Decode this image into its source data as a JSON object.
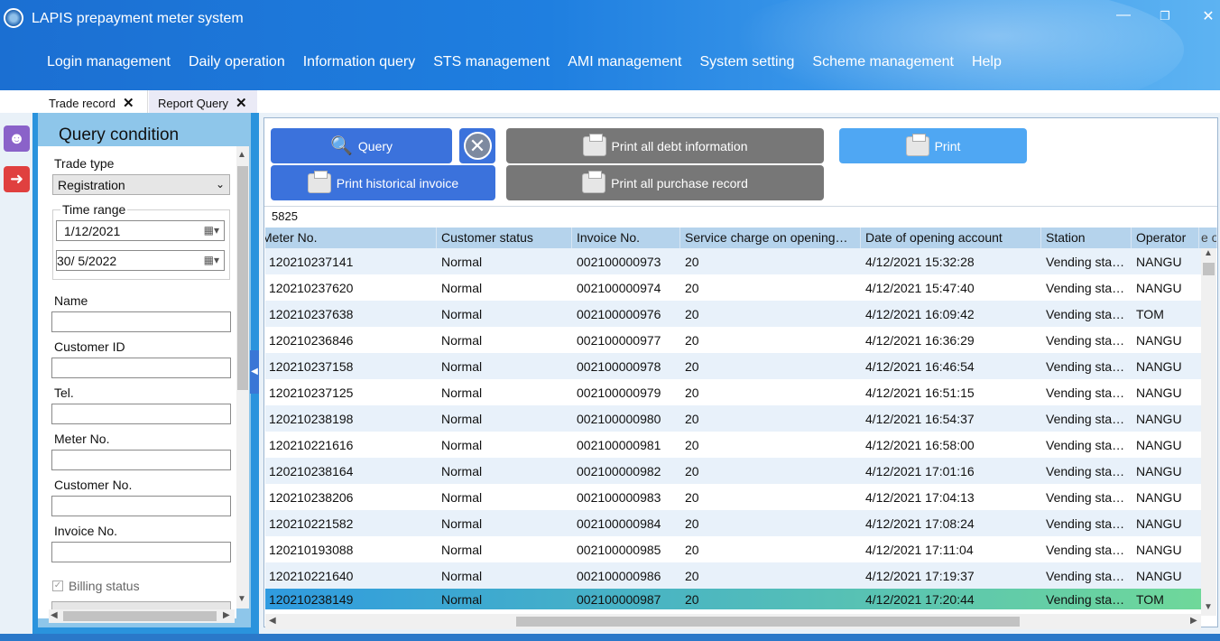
{
  "app": {
    "title": "LAPIS prepayment meter system"
  },
  "window_controls": {
    "minimize": "—",
    "restore": "❐",
    "close": "✕"
  },
  "menu": [
    "Login management",
    "Daily operation",
    "Information query",
    "STS management",
    "AMI management",
    "System setting",
    "Scheme management",
    "Help"
  ],
  "tabs": [
    {
      "label": "Trade record",
      "close": "✕"
    },
    {
      "label": "Report Query",
      "close": "✕"
    }
  ],
  "query": {
    "title": "Query condition",
    "trade_type_label": "Trade type",
    "trade_type_value": "Registration",
    "time_range_label": "Time range",
    "date_from": "1/12/2021",
    "date_to": "30/  5/2022",
    "fields": [
      "Name",
      "Customer ID",
      "Tel.",
      "Meter No.",
      "Customer No.",
      "Invoice No."
    ],
    "billing_status_label": "Billing status",
    "billing_status_checked": true
  },
  "toolbar": {
    "query": "Query",
    "print_debt": "Print all debt information",
    "print": "Print",
    "print_historical": "Print historical invoice",
    "print_purchase": "Print all purchase record"
  },
  "record_count": "5825",
  "table": {
    "columns": [
      "Meter No.",
      "Customer status",
      "Invoice No.",
      "Service charge on opening…",
      "Date of opening account",
      "Station",
      "Operator"
    ],
    "rows": [
      [
        "120210237141",
        "Normal",
        "002100000973",
        "20",
        "4/12/2021 15:32:28",
        "Vending sta…",
        "NANGU"
      ],
      [
        "120210237620",
        "Normal",
        "002100000974",
        "20",
        "4/12/2021 15:47:40",
        "Vending sta…",
        "NANGU"
      ],
      [
        "120210237638",
        "Normal",
        "002100000976",
        "20",
        "4/12/2021 16:09:42",
        "Vending sta…",
        "TOM"
      ],
      [
        "120210236846",
        "Normal",
        "002100000977",
        "20",
        "4/12/2021 16:36:29",
        "Vending sta…",
        "NANGU"
      ],
      [
        "120210237158",
        "Normal",
        "002100000978",
        "20",
        "4/12/2021 16:46:54",
        "Vending sta…",
        "NANGU"
      ],
      [
        "120210237125",
        "Normal",
        "002100000979",
        "20",
        "4/12/2021 16:51:15",
        "Vending sta…",
        "NANGU"
      ],
      [
        "120210238198",
        "Normal",
        "002100000980",
        "20",
        "4/12/2021 16:54:37",
        "Vending sta…",
        "NANGU"
      ],
      [
        "120210221616",
        "Normal",
        "002100000981",
        "20",
        "4/12/2021 16:58:00",
        "Vending sta…",
        "NANGU"
      ],
      [
        "120210238164",
        "Normal",
        "002100000982",
        "20",
        "4/12/2021 17:01:16",
        "Vending sta…",
        "NANGU"
      ],
      [
        "120210238206",
        "Normal",
        "002100000983",
        "20",
        "4/12/2021 17:04:13",
        "Vending sta…",
        "NANGU"
      ],
      [
        "120210221582",
        "Normal",
        "002100000984",
        "20",
        "4/12/2021 17:08:24",
        "Vending sta…",
        "NANGU"
      ],
      [
        "120210193088",
        "Normal",
        "002100000985",
        "20",
        "4/12/2021 17:11:04",
        "Vending sta…",
        "NANGU"
      ],
      [
        "120210221640",
        "Normal",
        "002100000986",
        "20",
        "4/12/2021 17:19:37",
        "Vending sta…",
        "NANGU"
      ],
      [
        "120210238149",
        "Normal",
        "002100000987",
        "20",
        "4/12/2021 17:20:44",
        "Vending sta…",
        "TOM"
      ]
    ],
    "selected_row": 13
  },
  "colors": {
    "accent": "#3b72dc",
    "header": "#b5d3ec",
    "row_alt": "#e8f1fa",
    "selected_start": "#2f9be0",
    "selected_end": "#6fd89a"
  }
}
